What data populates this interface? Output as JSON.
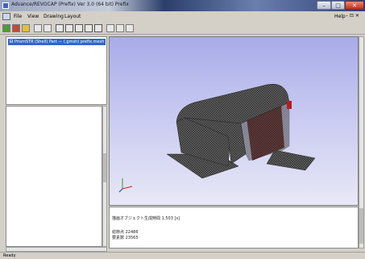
{
  "window": {
    "title": "Advance/REVOCAP (Prefix) Ver 3.0 (64 bit) Prefix",
    "controls": {
      "minimize": "–",
      "maximize": "□",
      "close": "✕"
    }
  },
  "menu": {
    "items": [
      "File",
      "View",
      "Drawing",
      "Layout"
    ],
    "help": "Help",
    "mdi_controls": "– ⊡ ✕"
  },
  "tree": {
    "expander": "⊟",
    "selected_item": "PrismSTR (Shell) Part — (.gmsh) prefix.mesh"
  },
  "log": {
    "line1": "描画オブジェクト生成時間 1.503 [s]",
    "line2": "総節点 22486",
    "line3": "要素数 23565"
  },
  "status": {
    "text": "Ready"
  },
  "icons": {
    "toolbar": [
      "open-icon",
      "save-icon",
      "import-icon",
      "view-fit-icon",
      "view-front-icon",
      "view-back-icon",
      "view-left-icon",
      "view-right-icon",
      "view-top-icon",
      "view-bottom-icon",
      "shade-icon",
      "wire-icon",
      "mesh-icon"
    ]
  },
  "colors": {
    "selection": "#3166c8",
    "viewport_top": "#a8abe8",
    "viewport_bottom": "#e8e8f6"
  }
}
